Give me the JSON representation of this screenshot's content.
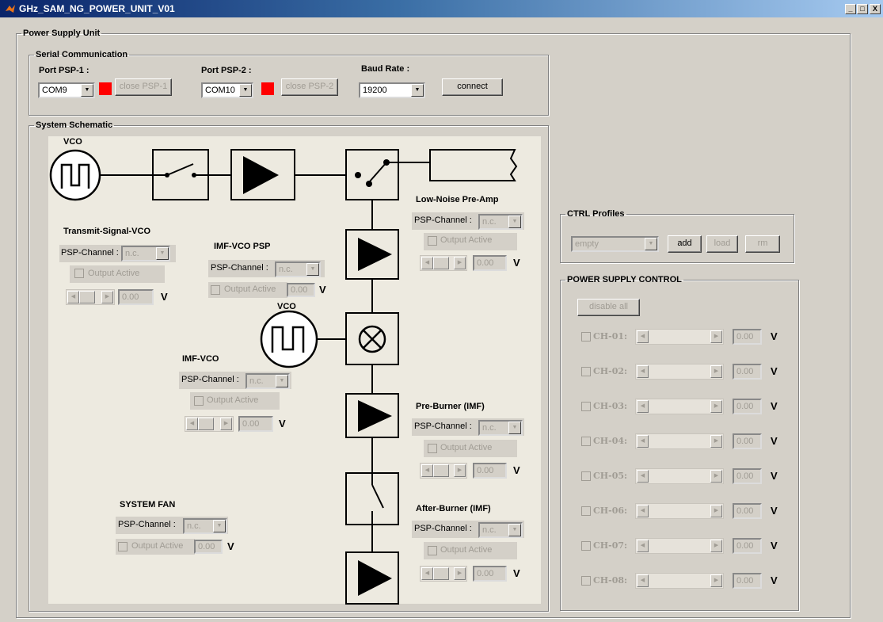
{
  "window": {
    "title": "GHz_SAM_NG_POWER_UNIT_V01",
    "minimize": "_",
    "maximize": "□",
    "close": "X"
  },
  "main_panel": {
    "title": "Power Supply Unit"
  },
  "serial": {
    "title": "Serial Communication",
    "psp1": {
      "label": "Port PSP-1 :",
      "port": "COM9",
      "close_label": "close PSP-1",
      "status_color": "#ff0000"
    },
    "psp2": {
      "label": "Port PSP-2 :",
      "port": "COM10",
      "close_label": "close PSP-2",
      "status_color": "#ff0000"
    },
    "baud": {
      "label": "Baud Rate :",
      "value": "19200"
    },
    "connect_label": "connect"
  },
  "schematic": {
    "title": "System Schematic",
    "vco_top_label": "VCO",
    "vco_mid_label": "VCO",
    "channel_label": "PSP-Channel :",
    "channel_value": "n.c.",
    "output_label": "Output Active",
    "voltage_value": "0.00",
    "unit": "V",
    "blocks": {
      "transmit_vco": "Transmit-Signal-VCO",
      "imf_vco_psp": "IMF-VCO PSP",
      "imf_vco": "IMF-VCO",
      "system_fan": "SYSTEM FAN",
      "lna": "Low-Noise Pre-Amp",
      "pre_burner": "Pre-Burner (IMF)",
      "after_burner": "After-Burner (IMF)"
    }
  },
  "ctrl_profiles": {
    "title": "CTRL Profiles",
    "selected": "empty",
    "add": "add",
    "load": "load",
    "rm": "rm"
  },
  "power_control": {
    "title": "POWER SUPPLY CONTROL",
    "disable_all": "disable all",
    "unit": "V",
    "channels": [
      {
        "label": "CH-01:",
        "value": "0.00"
      },
      {
        "label": "CH-02:",
        "value": "0.00"
      },
      {
        "label": "CH-03:",
        "value": "0.00"
      },
      {
        "label": "CH-04:",
        "value": "0.00"
      },
      {
        "label": "CH-05:",
        "value": "0.00"
      },
      {
        "label": "CH-06:",
        "value": "0.00"
      },
      {
        "label": "CH-07:",
        "value": "0.00"
      },
      {
        "label": "CH-08:",
        "value": "0.00"
      }
    ]
  }
}
